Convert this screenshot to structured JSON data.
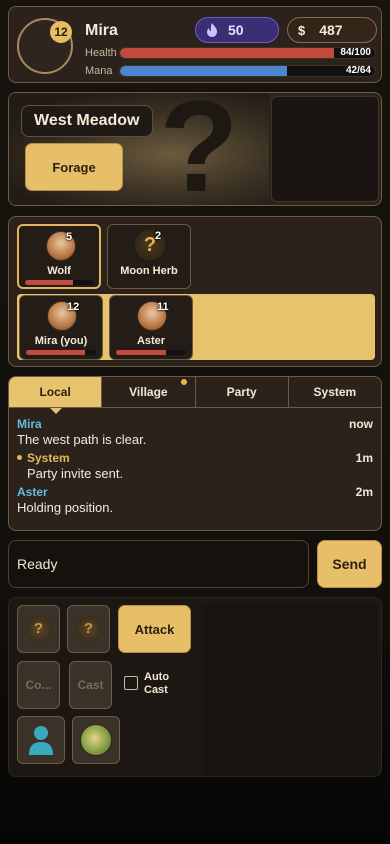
{
  "player": {
    "level": "12",
    "name": "Mira",
    "gems": "50",
    "gold_symbol": "$",
    "gold": "487",
    "health_label": "Health",
    "health_text": "84/100",
    "health_fraction": 0.84,
    "mana_label": "Mana",
    "mana_text": "42/64",
    "mana_fraction": 0.656
  },
  "colors": {
    "health": "#c14a3d",
    "mana": "#4a86cf",
    "accent_gold": "#e8c36e",
    "gem_purple": "#6b5bc8",
    "chat_author": "#68b9e0",
    "chat_system": "#e4b85a"
  },
  "location": {
    "name": "West Meadow",
    "forage_label": "Forage",
    "art_icon": "question-mark"
  },
  "entities": {
    "nearby": [
      {
        "name": "Wolf",
        "count": "5",
        "icon": "wolf-portrait",
        "hp_fraction": 0.7,
        "selected": true
      },
      {
        "name": "Moon Herb",
        "count": "2",
        "icon": "unknown-question",
        "hp_fraction": null,
        "selected": false
      }
    ],
    "party": [
      {
        "name": "Mira (you)",
        "count": "12",
        "icon": "player-portrait",
        "hp_fraction": 0.84
      },
      {
        "name": "Aster",
        "count": "11",
        "icon": "player-portrait",
        "hp_fraction": 0.72
      }
    ]
  },
  "chat": {
    "tabs": [
      {
        "label": "Local",
        "active": true,
        "unread": false
      },
      {
        "label": "Village",
        "active": false,
        "unread": true
      },
      {
        "label": "Party",
        "active": false,
        "unread": false
      },
      {
        "label": "System",
        "active": false,
        "unread": false
      }
    ],
    "messages": [
      {
        "author": "Mira",
        "time": "now",
        "text": "The west path is clear.",
        "system": false
      },
      {
        "author": "System",
        "time": "1m",
        "text": "Party invite sent.",
        "system": true
      },
      {
        "author": "Aster",
        "time": "2m",
        "text": "Holding position.",
        "system": false
      }
    ],
    "input_value": "Ready",
    "send_label": "Send"
  },
  "actions": {
    "attack_label": "Attack",
    "slot_co_label": "Co...",
    "slot_cast_label": "Cast",
    "auto_cast_label": "Auto Cast",
    "auto_cast_checked": false,
    "profile_icon": "person-icon",
    "map_icon": "map-icon"
  }
}
